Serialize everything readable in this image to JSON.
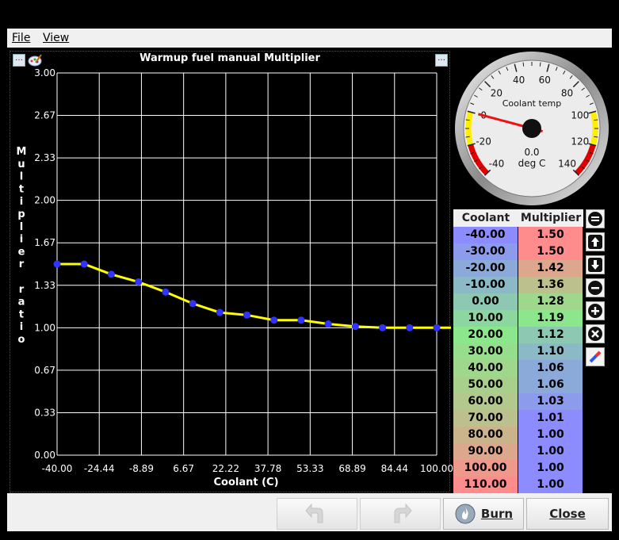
{
  "menu": {
    "file": "File",
    "view": "View"
  },
  "chart_title": "Warmup fuel manual Multiplier",
  "gauge": {
    "title": "Coolant temp",
    "value": "0.0",
    "unit": "deg C",
    "min": -40,
    "max": 140,
    "current": 0,
    "labels": [
      "-40",
      "-20",
      "0",
      "20",
      "40",
      "60",
      "80",
      "100",
      "120",
      "140"
    ]
  },
  "table": {
    "col1": "Coolant",
    "col2": "Multiplier",
    "rows": [
      [
        "-40.00",
        "1.50"
      ],
      [
        "-30.00",
        "1.50"
      ],
      [
        "-20.00",
        "1.42"
      ],
      [
        "-10.00",
        "1.36"
      ],
      [
        "0.00",
        "1.28"
      ],
      [
        "10.00",
        "1.19"
      ],
      [
        "20.00",
        "1.12"
      ],
      [
        "30.00",
        "1.10"
      ],
      [
        "40.00",
        "1.06"
      ],
      [
        "50.00",
        "1.06"
      ],
      [
        "60.00",
        "1.03"
      ],
      [
        "70.00",
        "1.01"
      ],
      [
        "80.00",
        "1.00"
      ],
      [
        "90.00",
        "1.00"
      ],
      [
        "100.00",
        "1.00"
      ],
      [
        "110.00",
        "1.00"
      ]
    ]
  },
  "buttons": {
    "burn": "Burn",
    "close": "Close"
  },
  "chart_data": {
    "type": "line",
    "title": "Warmup fuel manual Multiplier",
    "xlabel": "Coolant (C)",
    "ylabel": "Multiplier ratio",
    "xlim": [
      -40,
      100
    ],
    "ylim": [
      0,
      3
    ],
    "x_ticks": [
      "-40.00",
      "-24.44",
      "-8.89",
      "6.67",
      "22.22",
      "37.78",
      "53.33",
      "68.89",
      "84.44",
      "100.00"
    ],
    "y_ticks": [
      "0.00",
      "0.33",
      "0.67",
      "1.00",
      "1.33",
      "1.67",
      "2.00",
      "2.33",
      "2.67",
      "3.00"
    ],
    "x": [
      -40,
      -30,
      -20,
      -10,
      0,
      10,
      20,
      30,
      40,
      50,
      60,
      70,
      80,
      90,
      100,
      110
    ],
    "y": [
      1.5,
      1.5,
      1.42,
      1.36,
      1.28,
      1.19,
      1.12,
      1.1,
      1.06,
      1.06,
      1.03,
      1.01,
      1.0,
      1.0,
      1.0,
      1.0
    ],
    "line_color": "#ffff00",
    "point_color": "#3333ff",
    "grid": true
  }
}
